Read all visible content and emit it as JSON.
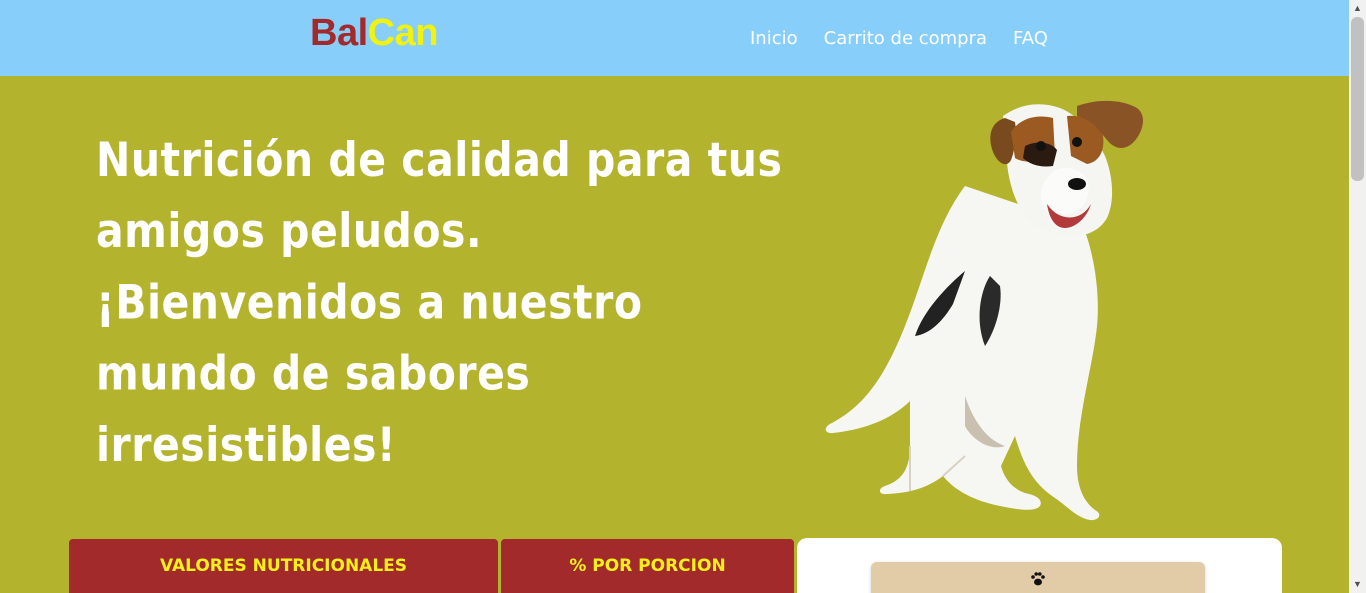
{
  "brand": {
    "part1": "Bal",
    "part2": "Can",
    "color1": "#a32a2a",
    "color2": "#f2f20f"
  },
  "nav": {
    "items": [
      "Inicio",
      "Carrito de compra",
      "FAQ"
    ]
  },
  "hero": {
    "headline": "Nutrición de calidad para tus amigos peludos. ¡Bienvenidos a nuestro mundo de sabores irresistibles!",
    "image": "dog-illustration"
  },
  "tabs": [
    {
      "label": "VALORES NUTRICIONALES"
    },
    {
      "label": "% POR PORCION"
    }
  ],
  "product_card": {
    "icon": "paw-icon"
  },
  "colors": {
    "header_bg": "#87cefa",
    "hero_bg": "#b3b32e",
    "tab_bg": "#a32a2a",
    "tab_text": "#f5f01a"
  }
}
